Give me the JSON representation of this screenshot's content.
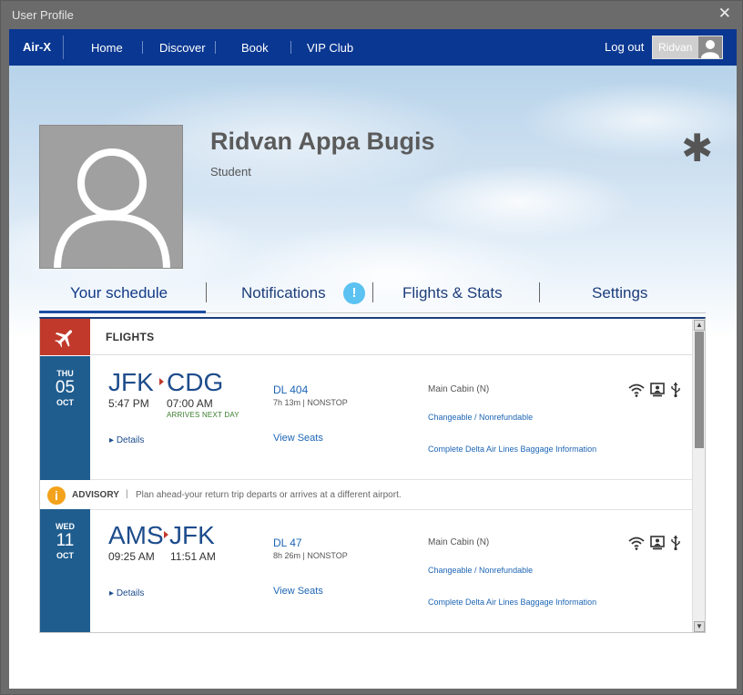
{
  "window": {
    "title": "User Profile",
    "close_glyph": "✕"
  },
  "nav": {
    "brand": "Air-X",
    "items": [
      "Home",
      "Discover",
      "Book",
      "VIP Club"
    ],
    "logout": "Log out",
    "user": "Ridvan"
  },
  "profile": {
    "name": "Ridvan Appa Bugis",
    "role": "Student",
    "settings_glyph": "✱"
  },
  "tabs": {
    "schedule": "Your schedule",
    "notifications": "Notifications",
    "notifications_badge": "!",
    "flights_stats": "Flights & Stats",
    "settings": "Settings"
  },
  "schedule": {
    "section_label": "FLIGHTS",
    "flights": [
      {
        "dow": "THU",
        "day": "05",
        "month": "OCT",
        "from": "JFK",
        "to": "CDG",
        "depart": "5:47 PM",
        "arrive": "07:00 AM",
        "note": "ARRIVES NEXT DAY",
        "details": "Details",
        "flight_no": "DL 404",
        "duration": "7h 13m | NONSTOP",
        "view_seats": "View Seats",
        "cabin": "Main Cabin (N)",
        "fare": "Changeable / Nonrefundable",
        "baggage": "Complete Delta Air Lines Baggage Information"
      },
      {
        "dow": "WED",
        "day": "11",
        "month": "OCT",
        "from": "AMS",
        "to": "JFK",
        "depart": "09:25 AM",
        "arrive": "11:51 AM",
        "note": "",
        "details": "Details",
        "flight_no": "DL 47",
        "duration": "8h 26m | NONSTOP",
        "view_seats": "View Seats",
        "cabin": "Main Cabin (N)",
        "fare": "Changeable / Nonrefundable",
        "baggage": "Complete Delta Air Lines Baggage Information"
      }
    ],
    "advisory": {
      "label": "ADVISORY",
      "separator": "|",
      "icon": "i",
      "text": "Plan ahead-your return trip departs or arrives at a different airport."
    }
  },
  "colors": {
    "nav_bg": "#0a3791",
    "date_col": "#1f5d8f",
    "flights_tile": "#c0392b",
    "advisory_icon": "#f3a21b",
    "notif_badge": "#5bc2f2"
  },
  "icons": [
    "close-icon",
    "user-avatar-icon",
    "settings-asterisk-icon",
    "plane-icon",
    "wifi-icon",
    "screen-icon",
    "usb-icon",
    "info-icon",
    "scroll-up-icon",
    "scroll-down-icon"
  ]
}
